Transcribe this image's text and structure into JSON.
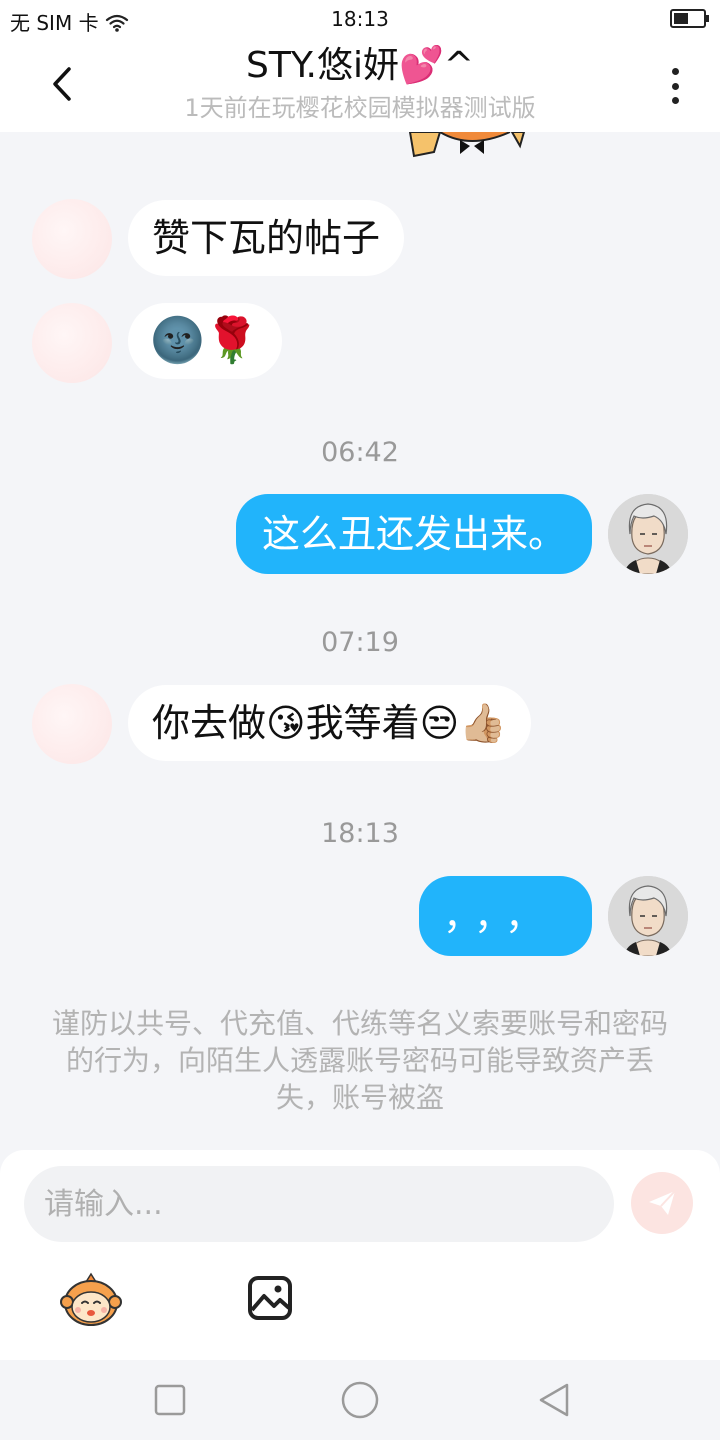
{
  "status_bar": {
    "carrier": "无 SIM 卡",
    "time": "18:13"
  },
  "header": {
    "title": "STY.悠i妍💕^",
    "subtitle": "1天前在玩樱花校园模拟器测试版"
  },
  "messages": [
    {
      "side": "in",
      "text": "赞下瓦的帖子"
    },
    {
      "side": "in",
      "text": "🌚🌹"
    },
    {
      "side": "time",
      "text": "06:42"
    },
    {
      "side": "out",
      "text": "这么丑还发出来。"
    },
    {
      "side": "time",
      "text": "07:19"
    },
    {
      "side": "in",
      "text": "你去做😘我等着😒👍🏼"
    },
    {
      "side": "time",
      "text": "18:13"
    },
    {
      "side": "out",
      "text": "，，，"
    }
  ],
  "warning": "谨防以共号、代充值、代练等名义索要账号和密码的行为，向陌生人透露账号密码可能导致资产丢失，账号被盗",
  "input": {
    "placeholder": "请输入..."
  },
  "colors": {
    "outgoing_bubble": "#21b4fb",
    "incoming_bubble": "#ffffff",
    "background": "#f4f5f8",
    "send_button": "#fce4e1"
  },
  "icons": {
    "back": "chevron-left-icon",
    "more": "more-vertical-icon",
    "send": "paper-plane-icon",
    "sticker": "monkey-sticker-icon",
    "image": "image-icon",
    "nav_recent": "square-icon",
    "nav_home": "circle-icon",
    "nav_back": "triangle-back-icon"
  }
}
